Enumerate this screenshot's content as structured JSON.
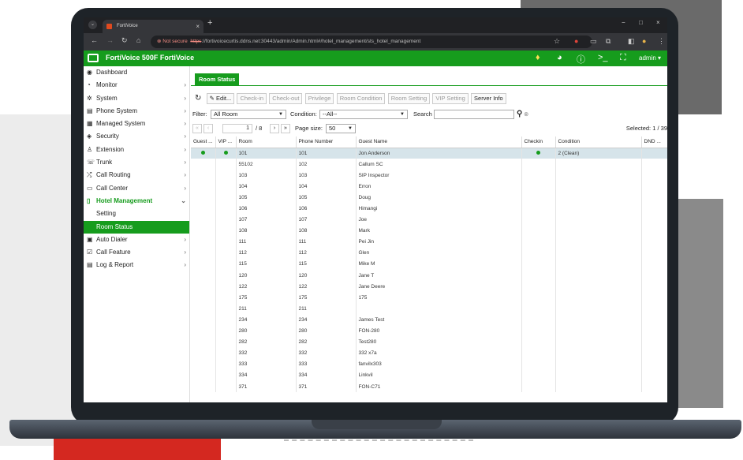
{
  "browser": {
    "tab_title": "FortiVoice",
    "tab_close": "×",
    "new_tab": "+",
    "not_secure": "Not secure",
    "url_scheme": "https",
    "url_rest": "://fortivoicecurtis.ddns.net:30443/admin/Admin.html#/hotel_management/sts_hotel_management"
  },
  "app": {
    "brand": "FortiVoice 500F  FortiVoice",
    "user": "admin"
  },
  "sidebar": {
    "items": [
      {
        "label": "Dashboard",
        "icon": "◉",
        "chev": ""
      },
      {
        "label": "Monitor",
        "icon": "◔",
        "chev": "›"
      },
      {
        "label": "System",
        "icon": "✲",
        "chev": "›"
      },
      {
        "label": "Phone System",
        "icon": "▤",
        "chev": "›"
      },
      {
        "label": "Managed System",
        "icon": "▦",
        "chev": "›"
      },
      {
        "label": "Security",
        "icon": "◈",
        "chev": "›"
      },
      {
        "label": "Extension",
        "icon": "♙",
        "chev": "›"
      },
      {
        "label": "Trunk",
        "icon": "☏",
        "chev": "›"
      },
      {
        "label": "Call Routing",
        "icon": "⤮",
        "chev": "›"
      },
      {
        "label": "Call Center",
        "icon": "▭",
        "chev": "›"
      },
      {
        "label": "Hotel Management",
        "icon": "▯",
        "chev": "⌄"
      },
      {
        "label": "Setting",
        "icon": "",
        "chev": ""
      },
      {
        "label": "Room Status",
        "icon": "",
        "chev": ""
      },
      {
        "label": "Auto Dialer",
        "icon": "▣",
        "chev": "›"
      },
      {
        "label": "Call Feature",
        "icon": "☑",
        "chev": "›"
      },
      {
        "label": "Log & Report",
        "icon": "▤",
        "chev": "›"
      }
    ]
  },
  "content": {
    "tab": "Room Status",
    "toolbar": {
      "refresh": "↻",
      "edit": "Edit...",
      "checkin": "Check-in",
      "checkout": "Check-out",
      "privilege": "Privilege",
      "room_condition": "Room Condition",
      "room_setting": "Room Setting",
      "vip_setting": "VIP Setting",
      "server_info": "Server Info"
    },
    "filter": {
      "filter_label": "Filter:",
      "filter_value": "All Room",
      "condition_label": "Condition:",
      "condition_value": "--All--",
      "search_label": "Search",
      "search_value": ""
    },
    "pager": {
      "first": "«",
      "prev": "‹",
      "page": "1",
      "of": "/ 8",
      "next": "›",
      "last": "»",
      "size_label": "Page size:",
      "size_value": "50",
      "selected": "Selected: 1 / 39"
    },
    "columns": [
      "Guest ...",
      "VIP ...",
      "Room",
      "Phone Number",
      "Guest Name",
      "Checkin",
      "Condition",
      "DND ..."
    ],
    "rows": [
      {
        "guest": true,
        "vip": true,
        "room": "101",
        "phone": "101",
        "name": "Jon Anderson",
        "checkin": true,
        "condition": "2 (Clean)"
      },
      {
        "guest": false,
        "vip": false,
        "room": "55102",
        "phone": "102",
        "name": "Callum SC",
        "checkin": false,
        "condition": ""
      },
      {
        "guest": false,
        "vip": false,
        "room": "103",
        "phone": "103",
        "name": "SIP Inspector",
        "checkin": false,
        "condition": ""
      },
      {
        "guest": false,
        "vip": false,
        "room": "104",
        "phone": "104",
        "name": "Erron",
        "checkin": false,
        "condition": ""
      },
      {
        "guest": false,
        "vip": false,
        "room": "105",
        "phone": "105",
        "name": "Doug",
        "checkin": false,
        "condition": ""
      },
      {
        "guest": false,
        "vip": false,
        "room": "106",
        "phone": "106",
        "name": "Himangi",
        "checkin": false,
        "condition": ""
      },
      {
        "guest": false,
        "vip": false,
        "room": "107",
        "phone": "107",
        "name": "Joe",
        "checkin": false,
        "condition": ""
      },
      {
        "guest": false,
        "vip": false,
        "room": "108",
        "phone": "108",
        "name": "Mark",
        "checkin": false,
        "condition": ""
      },
      {
        "guest": false,
        "vip": false,
        "room": "111",
        "phone": "111",
        "name": "Pei Jin",
        "checkin": false,
        "condition": ""
      },
      {
        "guest": false,
        "vip": false,
        "room": "112",
        "phone": "112",
        "name": "Glen",
        "checkin": false,
        "condition": ""
      },
      {
        "guest": false,
        "vip": false,
        "room": "115",
        "phone": "115",
        "name": "Mike M",
        "checkin": false,
        "condition": ""
      },
      {
        "guest": false,
        "vip": false,
        "room": "120",
        "phone": "120",
        "name": "Jane T",
        "checkin": false,
        "condition": ""
      },
      {
        "guest": false,
        "vip": false,
        "room": "122",
        "phone": "122",
        "name": "Jane Deere",
        "checkin": false,
        "condition": ""
      },
      {
        "guest": false,
        "vip": false,
        "room": "175",
        "phone": "175",
        "name": "175",
        "checkin": false,
        "condition": ""
      },
      {
        "guest": false,
        "vip": false,
        "room": "211",
        "phone": "211",
        "name": "",
        "checkin": false,
        "condition": ""
      },
      {
        "guest": false,
        "vip": false,
        "room": "234",
        "phone": "234",
        "name": "James Test",
        "checkin": false,
        "condition": ""
      },
      {
        "guest": false,
        "vip": false,
        "room": "280",
        "phone": "280",
        "name": "FON-280",
        "checkin": false,
        "condition": ""
      },
      {
        "guest": false,
        "vip": false,
        "room": "282",
        "phone": "282",
        "name": "Test280",
        "checkin": false,
        "condition": ""
      },
      {
        "guest": false,
        "vip": false,
        "room": "332",
        "phone": "332",
        "name": "332 x7a",
        "checkin": false,
        "condition": ""
      },
      {
        "guest": false,
        "vip": false,
        "room": "333",
        "phone": "333",
        "name": "fanvilx303",
        "checkin": false,
        "condition": ""
      },
      {
        "guest": false,
        "vip": false,
        "room": "334",
        "phone": "334",
        "name": "Linkvil",
        "checkin": false,
        "condition": ""
      },
      {
        "guest": false,
        "vip": false,
        "room": "371",
        "phone": "371",
        "name": "FON-C71",
        "checkin": false,
        "condition": ""
      }
    ]
  }
}
